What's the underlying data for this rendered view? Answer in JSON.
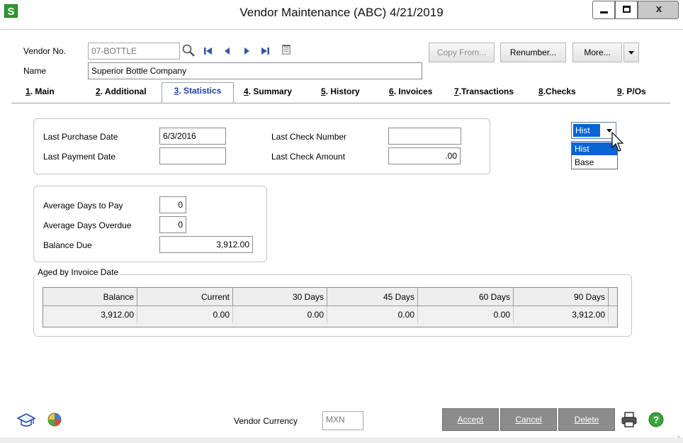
{
  "window": {
    "logo": "S",
    "title": "Vendor Maintenance (ABC) 4/21/2019",
    "close_glyph": "x"
  },
  "header": {
    "vendor_no_label": "Vendor No.",
    "vendor_no_value": "07-BOTTLE",
    "name_label": "Name",
    "name_value": "Superior Bottle Company",
    "copy_from_label": "Copy From...",
    "renumber_label": "Renumber...",
    "more_label": "More..."
  },
  "tabs": [
    {
      "key": "1",
      "label": ". Main"
    },
    {
      "key": "2",
      "label": ". Additional"
    },
    {
      "key": "3",
      "label": ". Statistics"
    },
    {
      "key": "4",
      "label": ". Summary"
    },
    {
      "key": "5",
      "label": ". History"
    },
    {
      "key": "6",
      "label": ". Invoices"
    },
    {
      "key": "7",
      "label": ".Transactions"
    },
    {
      "key": "8",
      "label": ".Checks"
    },
    {
      "key": "9",
      "label": ". P/Os"
    }
  ],
  "statistics": {
    "last_purchase_date_label": "Last Purchase Date",
    "last_purchase_date": "6/3/2016",
    "last_payment_date_label": "Last Payment Date",
    "last_payment_date": "",
    "last_check_number_label": "Last Check Number",
    "last_check_number": "",
    "last_check_amount_label": "Last Check Amount",
    "last_check_amount": ".00",
    "avg_days_to_pay_label": "Average Days to Pay",
    "avg_days_to_pay": "0",
    "avg_days_overdue_label": "Average Days Overdue",
    "avg_days_overdue": "0",
    "balance_due_label": "Balance Due",
    "balance_due": "3,912.00"
  },
  "view_select": {
    "selected": "Hist",
    "options": [
      "Hist",
      "Base"
    ]
  },
  "aged": {
    "title": "Aged by Invoice Date",
    "headers": [
      "Balance",
      "Current",
      "30 Days",
      "45 Days",
      "60 Days",
      "90 Days"
    ],
    "row": [
      "3,912.00",
      "0.00",
      "0.00",
      "0.00",
      "0.00",
      "3,912.00"
    ]
  },
  "footer": {
    "vendor_currency_label": "Vendor Currency",
    "vendor_currency": "MXN",
    "accept_label": "Accept",
    "cancel_label": "Cancel",
    "delete_label": "Delete"
  },
  "colors": {
    "accent_blue": "#0a64d2",
    "tab_active_text": "#1d3f9a",
    "logo_green": "#2a9a2a",
    "bottom_button_gray": "#8c8c8c",
    "help_green": "#3aa53a"
  },
  "icons": [
    "app-logo-icon",
    "lookup-icon",
    "first-record-icon",
    "prev-record-icon",
    "next-record-icon",
    "last-record-icon",
    "memo-icon",
    "dropdown-arrow-icon",
    "mouse-cursor-icon",
    "graduation-cap-icon",
    "globe-icon",
    "print-icon",
    "help-icon"
  ]
}
